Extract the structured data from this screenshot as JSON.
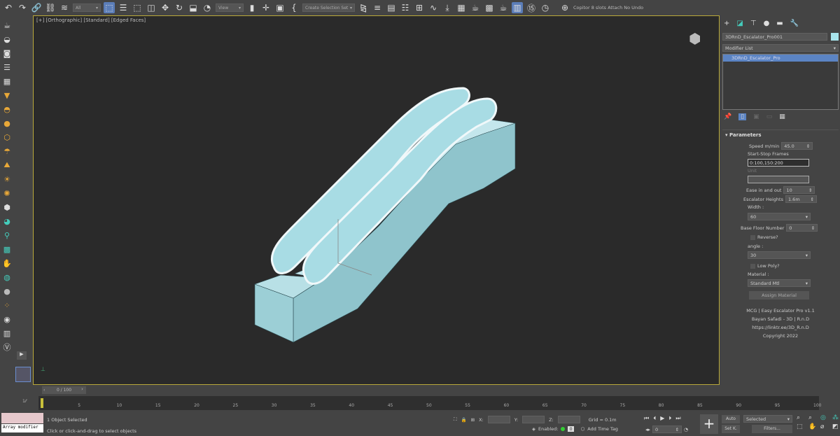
{
  "toolbar": {
    "selection_filter": "All",
    "ref_coord": "View",
    "selection_set": "Create Selection Set",
    "script_text": "Copitor 8 slots Attach No Undo"
  },
  "viewport": {
    "label": "[+] [Orthographic] [Standard] [Edged Faces]"
  },
  "command_panel": {
    "object_name": "3DRnD_Escalator_Pro001",
    "object_color": "#a8e4ec",
    "modifier_list": "Modifier List",
    "stack_items": [
      "3DRnD_Escalator_Pro"
    ],
    "rollout_title": "Parameters",
    "speed_label": "Speed m/min",
    "speed_value": "45.0",
    "start_stop_label": "Start-Stop Frames",
    "start_stop_value": "0:100,150:200",
    "unit_label": "Unit",
    "ease_label": "Ease in and out",
    "ease_value": "10",
    "heights_label": "Escalator Heights",
    "heights_value": "1.6m",
    "width_label": "Width :",
    "width_value": "60",
    "base_floor_label": "Base Floor Number",
    "base_floor_value": "0",
    "reverse_label": "Reverse?",
    "reverse_checked": false,
    "angle_label": "angle :",
    "angle_value": "30",
    "low_poly_label": "Low Poly?",
    "low_poly_checked": false,
    "material_label": "Material :",
    "material_value": "Standard Mtl",
    "assign_label": "Assign Material",
    "credits": [
      "MCG | Easy Escalator Pro v1.1",
      "Bayan Safadi - 3D | R.n.D",
      "https://linktr.ee/3D_R.n.D",
      "Copyright 2022"
    ]
  },
  "timeline": {
    "frame_display": "0 / 100",
    "ticks": [
      "0",
      "5",
      "10",
      "15",
      "20",
      "25",
      "30",
      "35",
      "40",
      "45",
      "50",
      "55",
      "60",
      "65",
      "70",
      "75",
      "80",
      "85",
      "90",
      "95",
      "100"
    ]
  },
  "status": {
    "maxscript_output": "Array modifier",
    "selection_text": "1 Object Selected",
    "prompt": "Click or click-and-drag to select objects",
    "x_label": "X:",
    "y_label": "Y:",
    "z_label": "Z:",
    "grid": "Grid = 0.1m",
    "enabled_label": "Enabled:",
    "enabled_value": "0",
    "add_time_tag": "Add Time Tag",
    "current_frame": "0",
    "auto": "Auto",
    "set_key": "Set K.",
    "key_filter": "Selected",
    "filters": "Filters..."
  }
}
